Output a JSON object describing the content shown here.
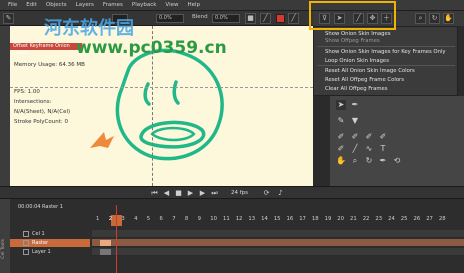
{
  "menubar": {
    "items": [
      "File",
      "Edit",
      "Objects",
      "Layers",
      "Frames",
      "Playback",
      "View",
      "Help"
    ]
  },
  "toolbar": {
    "blend_label": "Blend",
    "opacity_value": "0.0%",
    "opacity_value_2": "0.0%"
  },
  "watermark": {
    "logo_text": "河东软件园",
    "url_text": "www.pc0359.cn"
  },
  "stage": {
    "selected_layer_label": "Offset Keyframe Onion Colors",
    "memory_usage": "Memory Usage: 64.36 MB",
    "fps": "FPS: 1.00",
    "intersections_label": "Intersections:",
    "intersections_value": "N/A(Sheet), N/A(Cel)",
    "stroke_poly_count": "Stroke PolyCount: 0"
  },
  "onion_menu": {
    "items": [
      "Show Onion Skin Images",
      "Show Offpeg Frames",
      "Show Onion Skin Images for Key Frames Only",
      "Loop Onion Skin Images",
      "Reset All Onion Skin Image Colors",
      "Reset All Offpeg Frame Colors",
      "Clear All Offpeg Frames"
    ]
  },
  "playback": {
    "fps_value": "24 fps"
  },
  "timeline": {
    "current_frame_label": "00:00:04  Raster 1",
    "side_label": "Cel Tools",
    "layers": [
      {
        "name": "Cel 1",
        "selected": false
      },
      {
        "name": "Raster",
        "selected": true
      },
      {
        "name": "Layer 1",
        "selected": false
      }
    ],
    "frame_numbers": [
      "1",
      "2",
      "3",
      "4",
      "5",
      "6",
      "7",
      "8",
      "9",
      "10",
      "11",
      "12",
      "13",
      "14",
      "15",
      "16",
      "17",
      "18",
      "19",
      "20",
      "21",
      "22",
      "23",
      "24",
      "25",
      "26",
      "27",
      "28"
    ],
    "current_frame": "2"
  },
  "colors": {
    "accent_orange": "#c86a3a",
    "highlight_yellow": "#f0b400",
    "stroke_green": "#20b889",
    "arrow_orange": "#ef8a3c"
  }
}
